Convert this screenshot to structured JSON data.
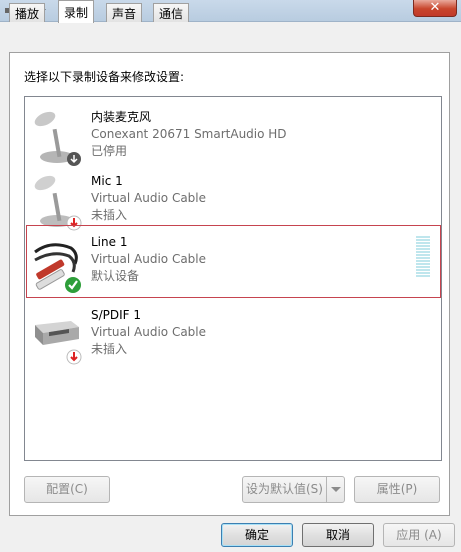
{
  "window": {
    "title": "声音",
    "close_label": "✕"
  },
  "tabs": [
    {
      "label": "播放"
    },
    {
      "label": "录制"
    },
    {
      "label": "声音"
    },
    {
      "label": "通信"
    }
  ],
  "instruction": "选择以下录制设备来修改设置:",
  "devices": [
    {
      "name": "内装麦克风",
      "driver": "Conexant 20671 SmartAudio HD",
      "status": "已停用",
      "icon": "microphone-icon",
      "badge": "disabled-down-arrow"
    },
    {
      "name": "Mic 1",
      "driver": "Virtual Audio Cable",
      "status": "未插入",
      "icon": "microphone-icon",
      "badge": "unplugged-red-arrow"
    },
    {
      "name": "Line 1",
      "driver": "Virtual Audio Cable",
      "status": "默认设备",
      "icon": "rca-cable-icon",
      "badge": "default-check",
      "selected": true
    },
    {
      "name": "S/PDIF 1",
      "driver": "Virtual Audio Cable",
      "status": "未插入",
      "icon": "spdif-box-icon",
      "badge": "unplugged-red-arrow"
    }
  ],
  "buttons": {
    "configure": "配置(C)",
    "set_default": "设为默认值(S)",
    "properties": "属性(P)",
    "ok": "确定",
    "cancel": "取消",
    "apply": "应用 (A)"
  },
  "colors": {
    "selection_border": "#c6444f",
    "accent": "#3c7fb1"
  }
}
